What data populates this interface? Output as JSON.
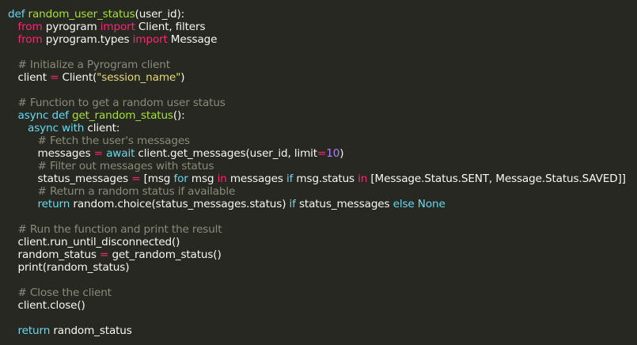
{
  "colors": {
    "background": "#272822",
    "text": "#f8f8f2",
    "keyword": "#66d9ef",
    "import_keyword": "#f92672",
    "operator": "#f92672",
    "function_name": "#a6e22e",
    "string": "#e6db74",
    "number": "#ae81ff",
    "comment": "#8b8b7a"
  },
  "code_lines": [
    [
      {
        "t": "def",
        "c": "keyword"
      },
      {
        "t": " "
      },
      {
        "t": "random_user_status",
        "c": "function_name"
      },
      {
        "t": "(user_id):"
      }
    ],
    [
      {
        "t": "   "
      },
      {
        "t": "from",
        "c": "import_keyword"
      },
      {
        "t": " pyrogram "
      },
      {
        "t": "import",
        "c": "import_keyword"
      },
      {
        "t": " Client, filters"
      }
    ],
    [
      {
        "t": "   "
      },
      {
        "t": "from",
        "c": "import_keyword"
      },
      {
        "t": " pyrogram.types "
      },
      {
        "t": "import",
        "c": "import_keyword"
      },
      {
        "t": " Message"
      }
    ],
    [],
    [
      {
        "t": "   "
      },
      {
        "t": "# Initialize a Pyrogram client",
        "c": "comment"
      }
    ],
    [
      {
        "t": "   client "
      },
      {
        "t": "=",
        "c": "operator"
      },
      {
        "t": " Client("
      },
      {
        "t": "\"session_name\"",
        "c": "string"
      },
      {
        "t": ")"
      }
    ],
    [],
    [
      {
        "t": "   "
      },
      {
        "t": "# Function to get a random user status",
        "c": "comment"
      }
    ],
    [
      {
        "t": "   "
      },
      {
        "t": "async",
        "c": "keyword"
      },
      {
        "t": " "
      },
      {
        "t": "def",
        "c": "keyword"
      },
      {
        "t": " "
      },
      {
        "t": "get_random_status",
        "c": "function_name"
      },
      {
        "t": "():"
      }
    ],
    [
      {
        "t": "      "
      },
      {
        "t": "async",
        "c": "keyword"
      },
      {
        "t": " "
      },
      {
        "t": "with",
        "c": "keyword"
      },
      {
        "t": " client:"
      }
    ],
    [
      {
        "t": "         "
      },
      {
        "t": "# Fetch the user's messages",
        "c": "comment"
      }
    ],
    [
      {
        "t": "         messages "
      },
      {
        "t": "=",
        "c": "operator"
      },
      {
        "t": " "
      },
      {
        "t": "await",
        "c": "keyword"
      },
      {
        "t": " client.get_messages(user_id, limit"
      },
      {
        "t": "=",
        "c": "operator"
      },
      {
        "t": "10",
        "c": "number"
      },
      {
        "t": ")"
      }
    ],
    [
      {
        "t": "         "
      },
      {
        "t": "# Filter out messages with status",
        "c": "comment"
      }
    ],
    [
      {
        "t": "         status_messages "
      },
      {
        "t": "=",
        "c": "operator"
      },
      {
        "t": " [msg "
      },
      {
        "t": "for",
        "c": "keyword"
      },
      {
        "t": " msg "
      },
      {
        "t": "in",
        "c": "operator"
      },
      {
        "t": " messages "
      },
      {
        "t": "if",
        "c": "keyword"
      },
      {
        "t": " msg.status "
      },
      {
        "t": "in",
        "c": "operator"
      },
      {
        "t": " [Message.Status.SENT, Message.Status.SAVED]]"
      }
    ],
    [
      {
        "t": "         "
      },
      {
        "t": "# Return a random status if available",
        "c": "comment"
      }
    ],
    [
      {
        "t": "         "
      },
      {
        "t": "return",
        "c": "keyword"
      },
      {
        "t": " random.choice(status_messages.status) "
      },
      {
        "t": "if",
        "c": "keyword"
      },
      {
        "t": " status_messages "
      },
      {
        "t": "else",
        "c": "keyword"
      },
      {
        "t": " "
      },
      {
        "t": "None",
        "c": "keyword"
      }
    ],
    [],
    [
      {
        "t": "   "
      },
      {
        "t": "# Run the function and print the result",
        "c": "comment"
      }
    ],
    [
      {
        "t": "   client.run_until_disconnected()"
      }
    ],
    [
      {
        "t": "   random_status "
      },
      {
        "t": "=",
        "c": "operator"
      },
      {
        "t": " get_random_status()"
      }
    ],
    [
      {
        "t": "   print(random_status)"
      }
    ],
    [],
    [
      {
        "t": "   "
      },
      {
        "t": "# Close the client",
        "c": "comment"
      }
    ],
    [
      {
        "t": "   client.close()"
      }
    ],
    [],
    [
      {
        "t": "   "
      },
      {
        "t": "return",
        "c": "keyword"
      },
      {
        "t": " random_status"
      }
    ]
  ]
}
